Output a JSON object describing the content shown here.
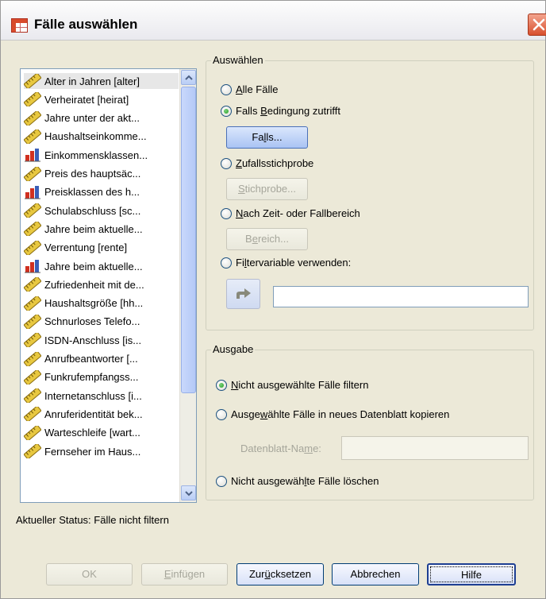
{
  "window": {
    "title": "Fälle auswählen"
  },
  "variables": [
    {
      "label": "Alter in Jahren [alter]",
      "type": "scale"
    },
    {
      "label": "Verheiratet [heirat]",
      "type": "scale"
    },
    {
      "label": "Jahre unter der akt...",
      "type": "scale"
    },
    {
      "label": "Haushaltseinkomme...",
      "type": "scale"
    },
    {
      "label": "Einkommensklassen...",
      "type": "ordinal"
    },
    {
      "label": "Preis des hauptsäc...",
      "type": "scale"
    },
    {
      "label": "Preisklassen des h...",
      "type": "ordinal"
    },
    {
      "label": "Schulabschluss [sc...",
      "type": "scale"
    },
    {
      "label": "Jahre beim aktuelle...",
      "type": "scale"
    },
    {
      "label": "Verrentung [rente]",
      "type": "scale"
    },
    {
      "label": "Jahre beim aktuelle...",
      "type": "ordinal"
    },
    {
      "label": "Zufriedenheit mit de...",
      "type": "scale"
    },
    {
      "label": "Haushaltsgröße [hh...",
      "type": "scale"
    },
    {
      "label": "Schnurloses Telefo...",
      "type": "scale"
    },
    {
      "label": "ISDN-Anschluss [is...",
      "type": "scale"
    },
    {
      "label": "Anrufbeantworter [...",
      "type": "scale"
    },
    {
      "label": "Funkrufempfangss...",
      "type": "scale"
    },
    {
      "label": "Internetanschluss [i...",
      "type": "scale"
    },
    {
      "label": "Anruferidentität bek...",
      "type": "scale"
    },
    {
      "label": "Warteschleife [wart...",
      "type": "scale"
    },
    {
      "label": "Fernseher im Haus...",
      "type": "scale"
    }
  ],
  "select": {
    "group_label": "Auswählen",
    "all_cases": {
      "pre": "",
      "key": "A",
      "post": "lle Fälle",
      "checked": false
    },
    "if_condition": {
      "pre": "Falls ",
      "key": "B",
      "post": "edingung zutrifft",
      "checked": true
    },
    "if_button": {
      "pre": "Fa",
      "key": "l",
      "post": "ls..."
    },
    "random_sample": {
      "pre": "",
      "key": "Z",
      "post": "ufallsstichprobe",
      "checked": false
    },
    "sample_button": {
      "pre": "",
      "key": "S",
      "post": "tichprobe..."
    },
    "time_range": {
      "pre": "",
      "key": "N",
      "post": "ach Zeit- oder Fallbereich",
      "checked": false
    },
    "range_button": {
      "pre": "B",
      "key": "e",
      "post": "reich..."
    },
    "filter_variable": {
      "pre": "Fi",
      "key": "l",
      "post": "tervariable verwenden:",
      "checked": false
    },
    "filter_input_value": ""
  },
  "output": {
    "group_label": "Ausgabe",
    "filter_unselected": {
      "pre": "",
      "key": "N",
      "post": "icht ausgewählte Fälle filtern",
      "checked": true
    },
    "copy_selected": {
      "pre": "Ausge",
      "key": "w",
      "post": "ählte Fälle in neues Datenblatt kopieren",
      "checked": false
    },
    "dataset_name": {
      "pre": "Datenblatt-Na",
      "key": "m",
      "post": "e:",
      "value": ""
    },
    "delete_unselected": {
      "pre": "Nicht ausgewäh",
      "key": "l",
      "post": "te Fälle löschen",
      "checked": false
    }
  },
  "status": {
    "text": "Aktueller Status: Fälle nicht filtern"
  },
  "buttons": {
    "ok": "OK",
    "paste": {
      "pre": "",
      "key": "E",
      "post": "infügen"
    },
    "reset": {
      "pre": "Zur",
      "key": "ü",
      "post": "cksetzen"
    },
    "cancel": "Abbrechen",
    "help": "Hilfe"
  },
  "colors": {
    "dialog_bg": "#ece9d8",
    "close_button": "#d8502e",
    "radio_checked": "#21a121",
    "scale_icon": "#e8c840",
    "ordinal_icon_red": "#d03020"
  }
}
